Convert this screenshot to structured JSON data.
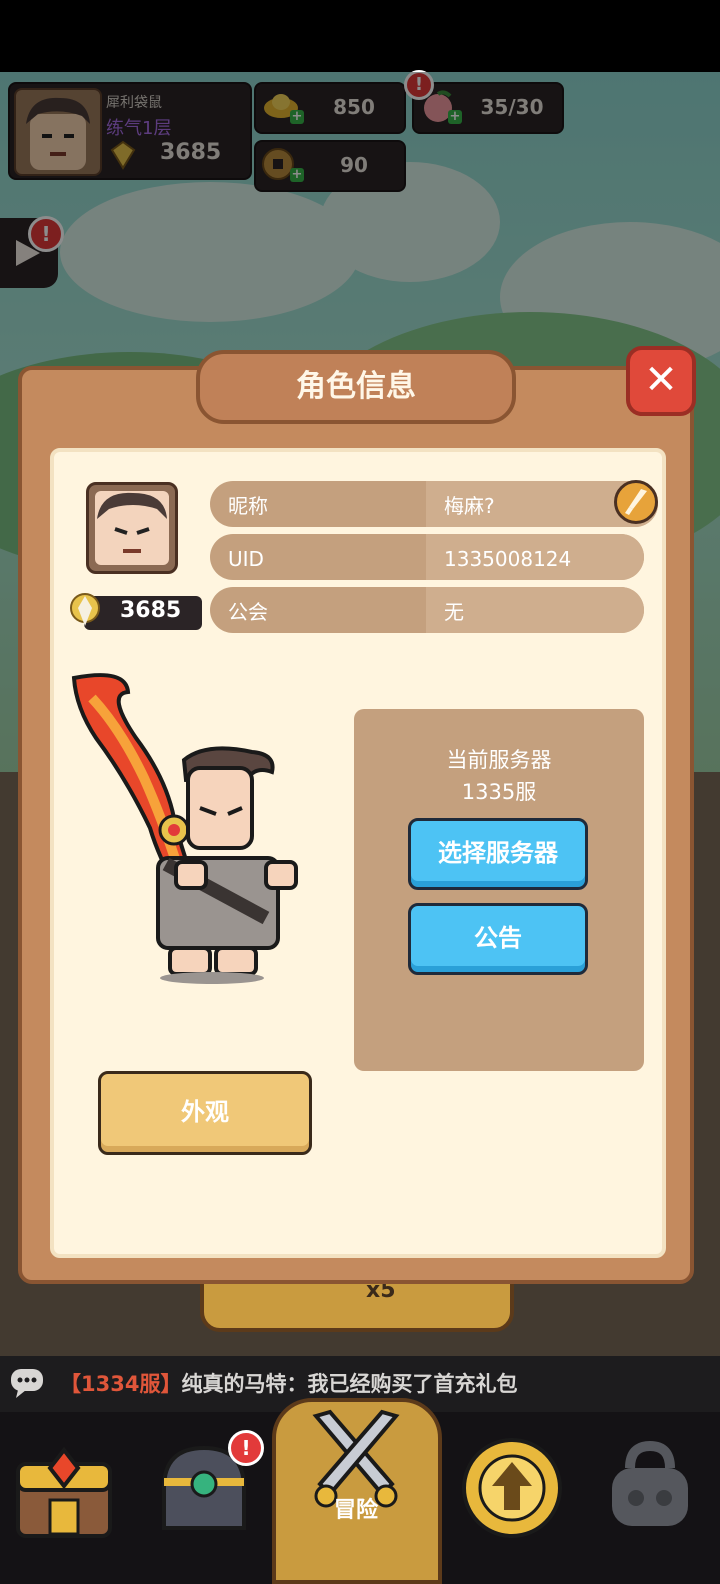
{
  "player": {
    "name": "犀利袋鼠",
    "level": "练气1层",
    "power": "3685"
  },
  "resources": {
    "gold": "850",
    "stamina": "35/30",
    "coins": "90"
  },
  "dialog": {
    "title": "角色信息",
    "power": "3685",
    "rows": [
      {
        "label": "昵称",
        "value": "梅麻?"
      },
      {
        "label": "UID",
        "value": "1335008124"
      },
      {
        "label": "公会",
        "value": "无"
      }
    ],
    "server_label": "当前服务器",
    "server_value": "1335服",
    "select_server": "选择服务器",
    "announcement": "公告",
    "appearance": "外观"
  },
  "behind": {
    "multiplier": "x5"
  },
  "chat": {
    "server": "【1334服】",
    "message": "纯真的马特：我已经购买了首充礼包"
  },
  "nav": {
    "adventure": "冒险"
  },
  "colors": {
    "accent_blue": "#4dc3f4",
    "alert_red": "#e23a3a",
    "panel_brown": "#c48a5e"
  }
}
